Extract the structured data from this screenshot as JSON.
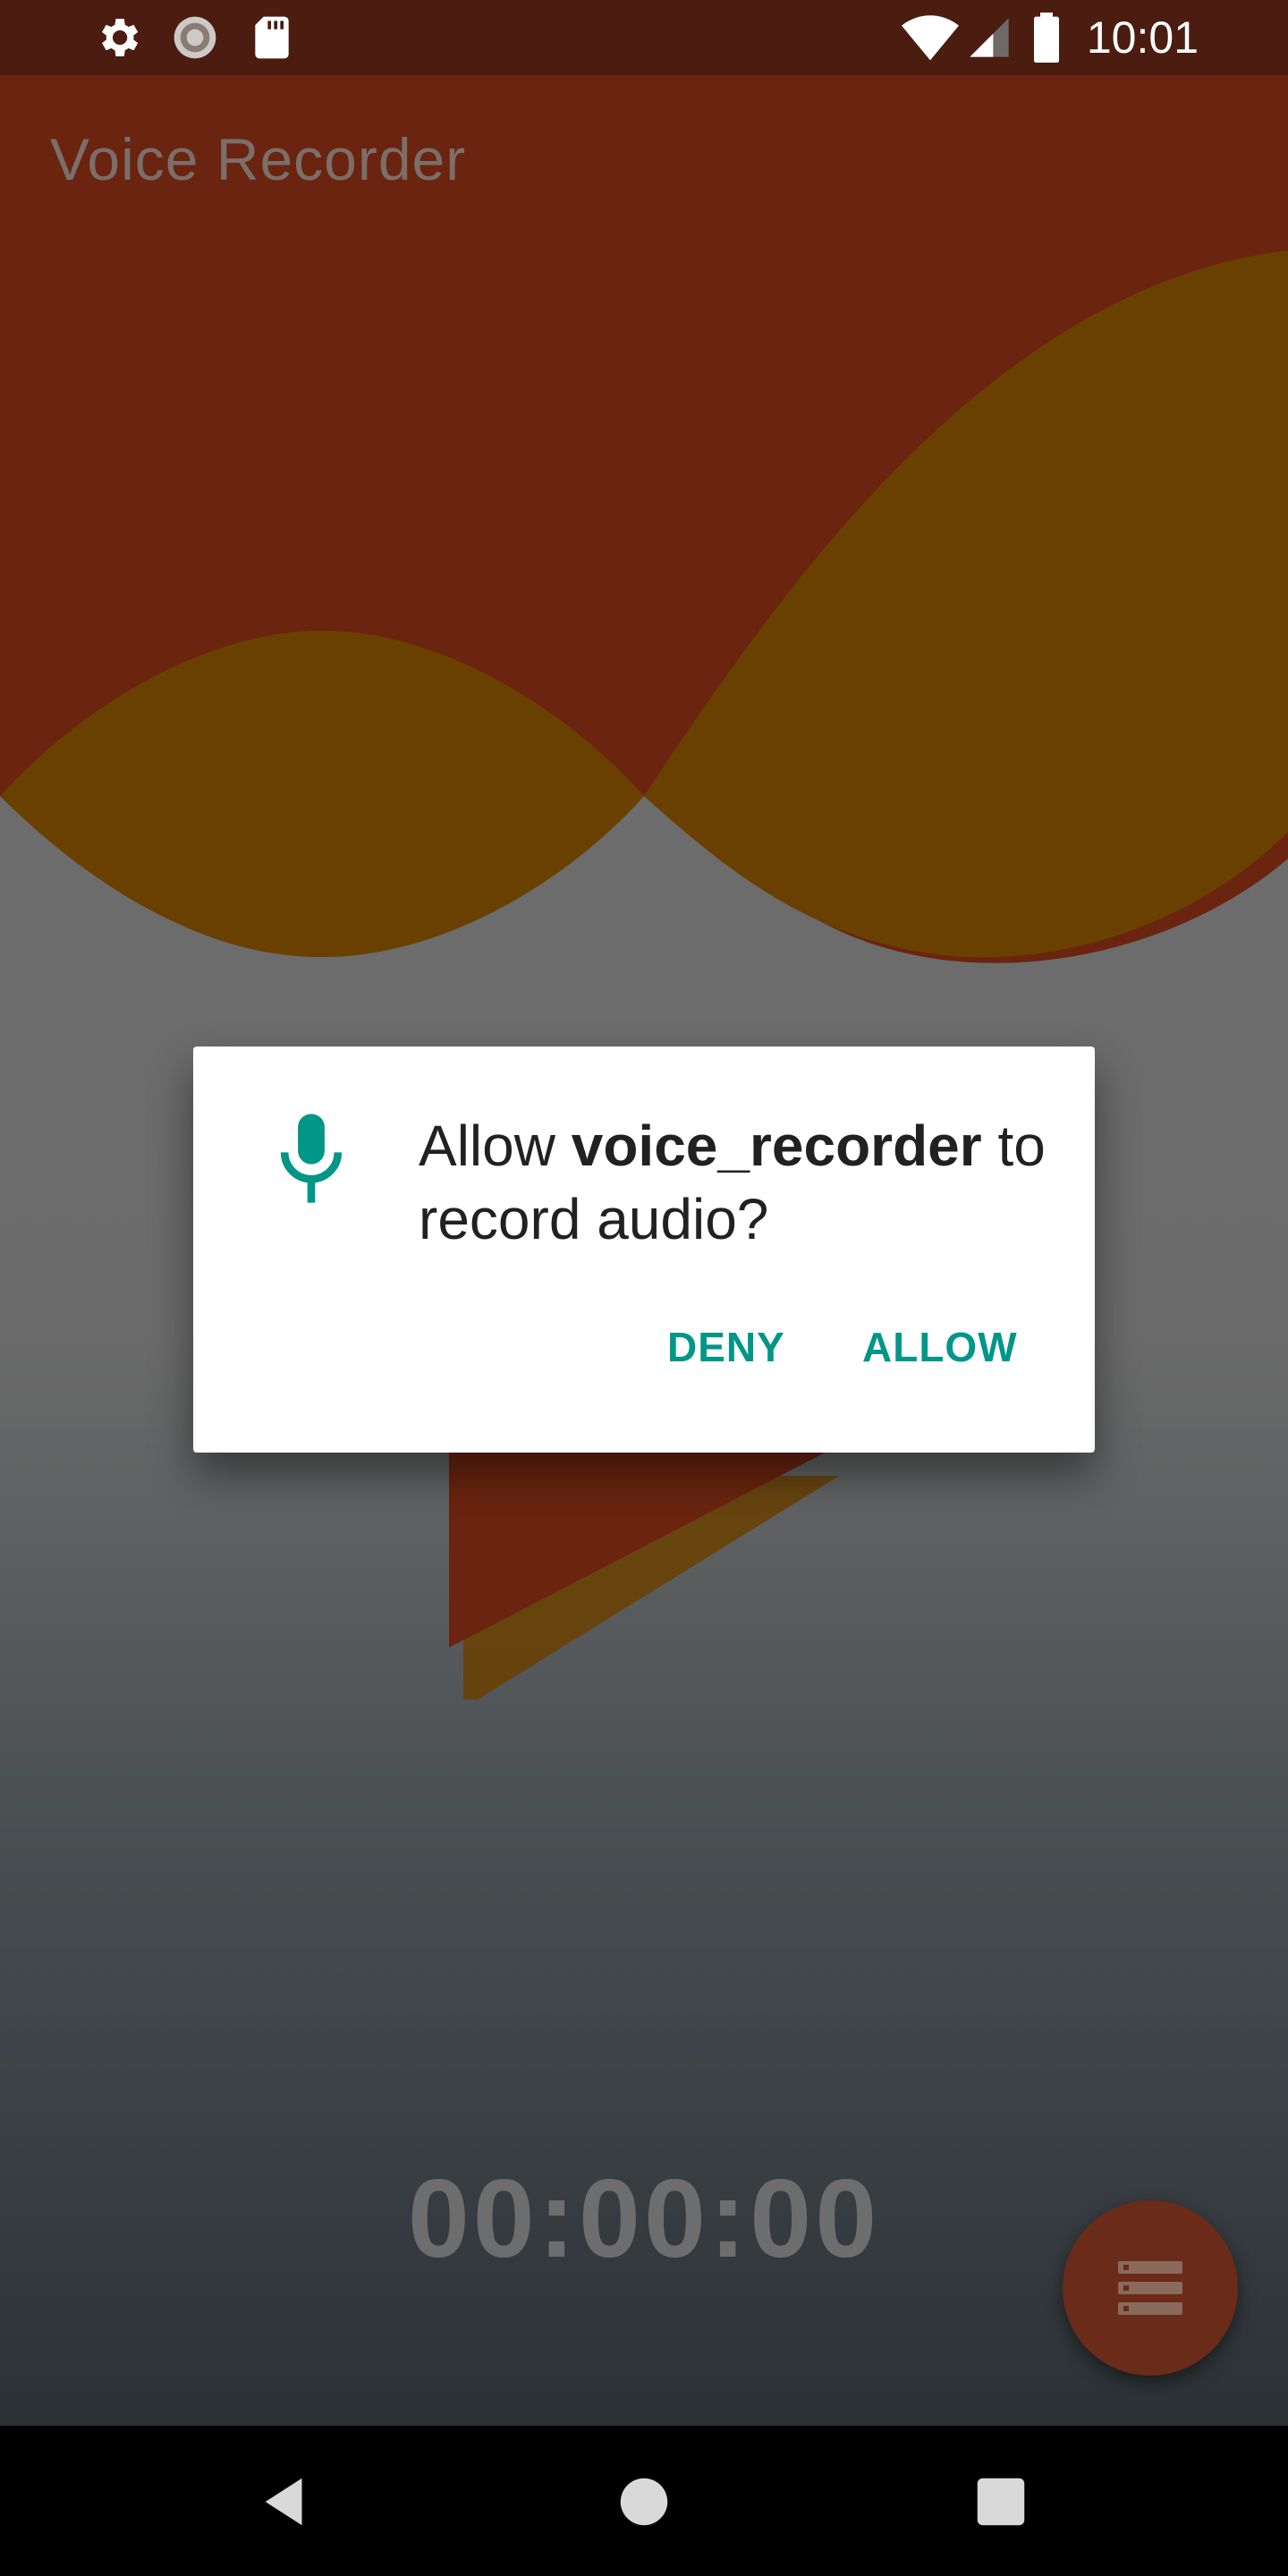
{
  "status_bar": {
    "time": "10:01",
    "left_icons": [
      "settings-icon",
      "sync-icon",
      "sd-card-icon"
    ],
    "right_icons": [
      "wifi-icon",
      "cellular-signal-icon",
      "battery-icon"
    ]
  },
  "app": {
    "title": "Voice Recorder",
    "timer": "00:00:00",
    "accent_colors": {
      "wave_red": "#6a2410",
      "wave_gold": "#6a4000",
      "fab": "#6a2b19"
    },
    "list_button_icon": "list-icon"
  },
  "dialog": {
    "icon": "microphone-icon",
    "message_prefix": "Allow ",
    "app_name": "voice_recorder",
    "message_suffix": " to record audio?",
    "deny_label": "DENY",
    "allow_label": "ALLOW",
    "button_color": "#009688"
  },
  "nav_bar": {
    "buttons": [
      "back-icon",
      "home-icon",
      "recents-icon"
    ]
  }
}
